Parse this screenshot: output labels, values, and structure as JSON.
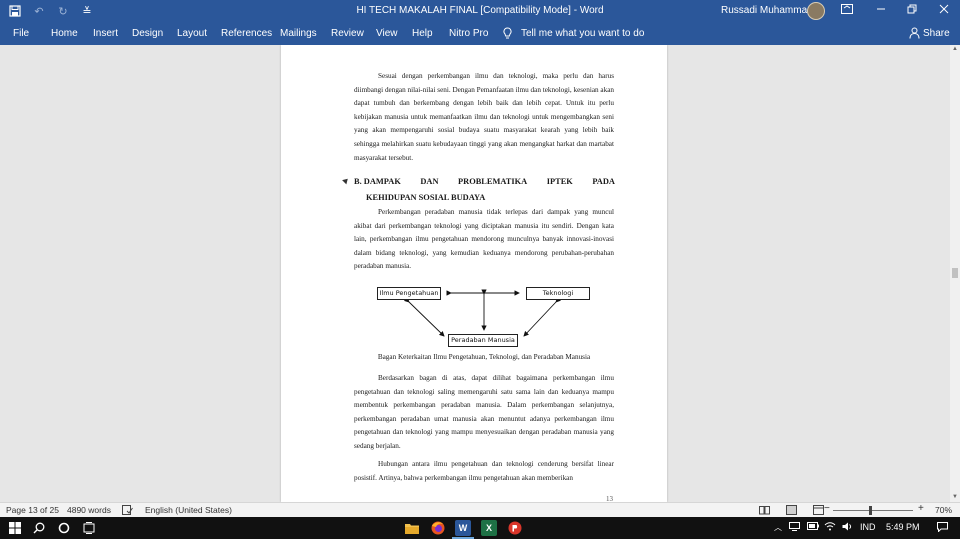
{
  "titlebar": {
    "document_title": "HI TECH MAKALAH FINAL [Compatibility Mode]  -  Word",
    "user_name": "Russadi Muhammad",
    "icons": [
      "save-icon",
      "undo-icon",
      "redo-icon",
      "customize-quick-access-icon",
      "ribbon-display-options-icon",
      "minimize-icon",
      "restore-icon",
      "close-icon"
    ]
  },
  "ribbon": {
    "tabs": [
      "File",
      "Home",
      "Insert",
      "Design",
      "Layout",
      "References",
      "Mailings",
      "Review",
      "View",
      "Help",
      "Nitro Pro"
    ],
    "tell_me": "Tell me what you want to do",
    "share": "Share"
  },
  "document": {
    "paragraph_1": "Sesuai dengan perkembangan ilmu dan teknologi, maka perlu dan harus diimbangi dengan nilai-nilai seni. Dengan Pemanfaatan ilmu dan teknologi, kesenian akan dapat tumbuh dan berkembang dengan lebih baik dan lebih cepat. Untuk itu perlu kebijakan manusia untuk memanfaatkan ilmu dan teknologi untuk mengembangkan seni yang akan mempengaruhi sosial budaya suatu masyarakat kearah yang lebih baik sehingga melahirkan suatu kebudayaan tinggi yang akan mengangkat harkat dan martabat masyarakat tersebut.",
    "heading_words": [
      "B. DAMPAK",
      "DAN",
      "PROBLEMATIKA",
      "IPTEK",
      "PADA"
    ],
    "heading_line2": "KEHIDUPAN SOSIAL BUDAYA",
    "paragraph_2": "Perkembangan peradaban manusia tidak terlepas dari dampak yang muncul akibat dari perkembangan teknologi yang diciptakan manusia itu sendiri. Dengan kata lain, perkembangan ilmu pengetahuan mendorong munculnya banyak innovasi-inovasi dalam bidang teknologi, yang kemudian keduanya mendorong perubahan-perubahan peradaban manusia.",
    "diagram": {
      "box_left": "Ilmu Pengetahuan",
      "box_right": "Teknologi",
      "box_bottom": "Peradaban Manusia"
    },
    "caption": "Bagan Keterkaitan Ilmu Pengetahuan, Teknologi, dan Peradaban Manusia",
    "paragraph_3": "Berdasarkan bagan di atas, dapat dilihat bagaimana perkembangan ilmu pengetahuan dan teknologi saling memengaruhi satu sama lain dan keduanya mampu membentuk perkembangan peradaban manusia. Dalam perkembangan selanjutnya, perkembangan peradaban umat manusia akan menuntut adanya perkembangan ilmu pengetahuan dan teknologi yang mampu menyesuaikan dengan peradaban manusia yang sedang berjalan.",
    "paragraph_4": "Hubungan antara ilmu pengetahuan dan teknologi cenderung bersifat linear posistif. Artinya, bahwa perkembangan ilmu pengetahuan akan memberikan",
    "page_number": "13"
  },
  "statusbar": {
    "page": "Page 13 of 25",
    "words": "4890 words",
    "language": "English (United States)",
    "zoom": "70%"
  },
  "taskbar": {
    "apps": [
      "file-explorer-icon",
      "firefox-icon",
      "word-icon",
      "excel-icon",
      "pdf-icon"
    ],
    "language": "IND",
    "time": "5:49 PM"
  }
}
